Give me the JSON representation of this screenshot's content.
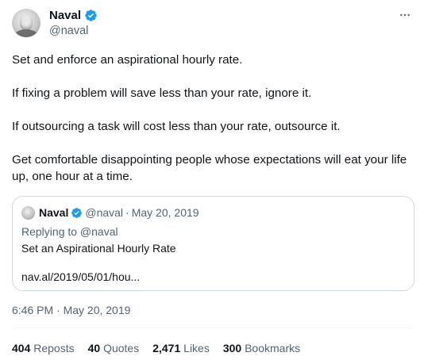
{
  "author": {
    "display_name": "Naval",
    "handle": "@naval",
    "verified_color": "#1d9bf0"
  },
  "tweet": {
    "paragraphs": [
      "Set and enforce an aspirational hourly rate.",
      "If fixing a problem will save less than your rate, ignore it.",
      "If outsourcing a task will cost less than your rate, outsource it.",
      "Get comfortable disappointing people whose expectations will eat your life up, one hour at a time."
    ],
    "timestamp": "6:46 PM · May 20, 2019"
  },
  "quote": {
    "display_name": "Naval",
    "handle": "@naval",
    "separator": "·",
    "date": "May 20, 2019",
    "reply_line": "Replying to @naval",
    "text": "Set an Aspirational Hourly Rate",
    "link": "nav.al/2019/05/01/hou..."
  },
  "stats": [
    {
      "value": "404",
      "label": "Reposts"
    },
    {
      "value": "40",
      "label": "Quotes"
    },
    {
      "value": "2,471",
      "label": "Likes"
    },
    {
      "value": "300",
      "label": "Bookmarks"
    }
  ],
  "icons": {
    "verified": "verified-badge-icon",
    "more": "more-horizontal-icon"
  }
}
